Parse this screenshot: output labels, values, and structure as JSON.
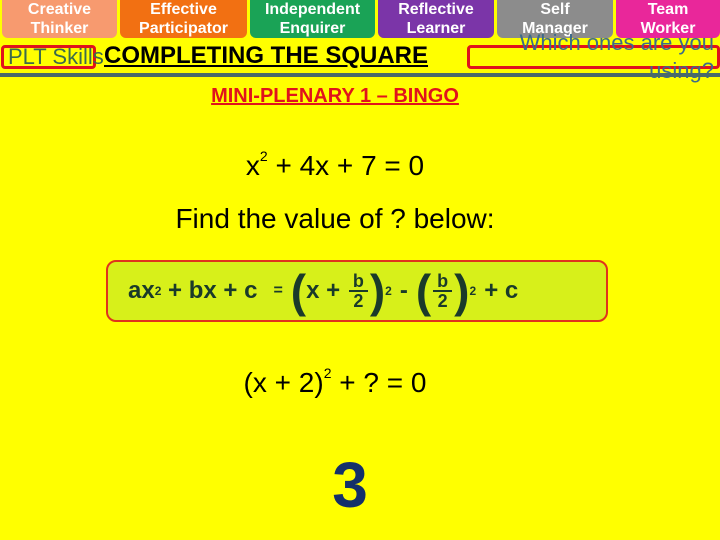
{
  "plt_skills": [
    {
      "line1": "Creative",
      "line2": "Thinker",
      "color": "#f79a6f"
    },
    {
      "line1": "Effective",
      "line2": "Participator",
      "color": "#f27012"
    },
    {
      "line1": "Independent",
      "line2": "Enquirer",
      "color": "#1aa356"
    },
    {
      "line1": "Reflective",
      "line2": "Learner",
      "color": "#7b35a8"
    },
    {
      "line1": "Self",
      "line2": "Manager",
      "color": "#8c8c8c"
    },
    {
      "line1": "Team",
      "line2": "Worker",
      "color": "#e9279a"
    }
  ],
  "header": {
    "plt_label": "PLT Skills",
    "title": "COMPLETING THE SQUARE",
    "question": "Which ones are you using?"
  },
  "content": {
    "subtitle": "MINI-PLENARY 1 – BINGO",
    "equation": {
      "pre": "x",
      "exp": "2",
      "post": " + 4x + 7 = 0"
    },
    "prompt": "Find the value of ? below:",
    "formula": {
      "lhs_a": "ax",
      "exp": "2",
      "lhs_rest": " + bx + c",
      "eq": "=",
      "x_plus": "x + ",
      "num": "b",
      "den": "2",
      "minus": "-",
      "plus_c": "+ c"
    },
    "step": {
      "pre": "(x + 2)",
      "exp": "2",
      "post": " + ? = 0"
    },
    "answer": "3"
  }
}
